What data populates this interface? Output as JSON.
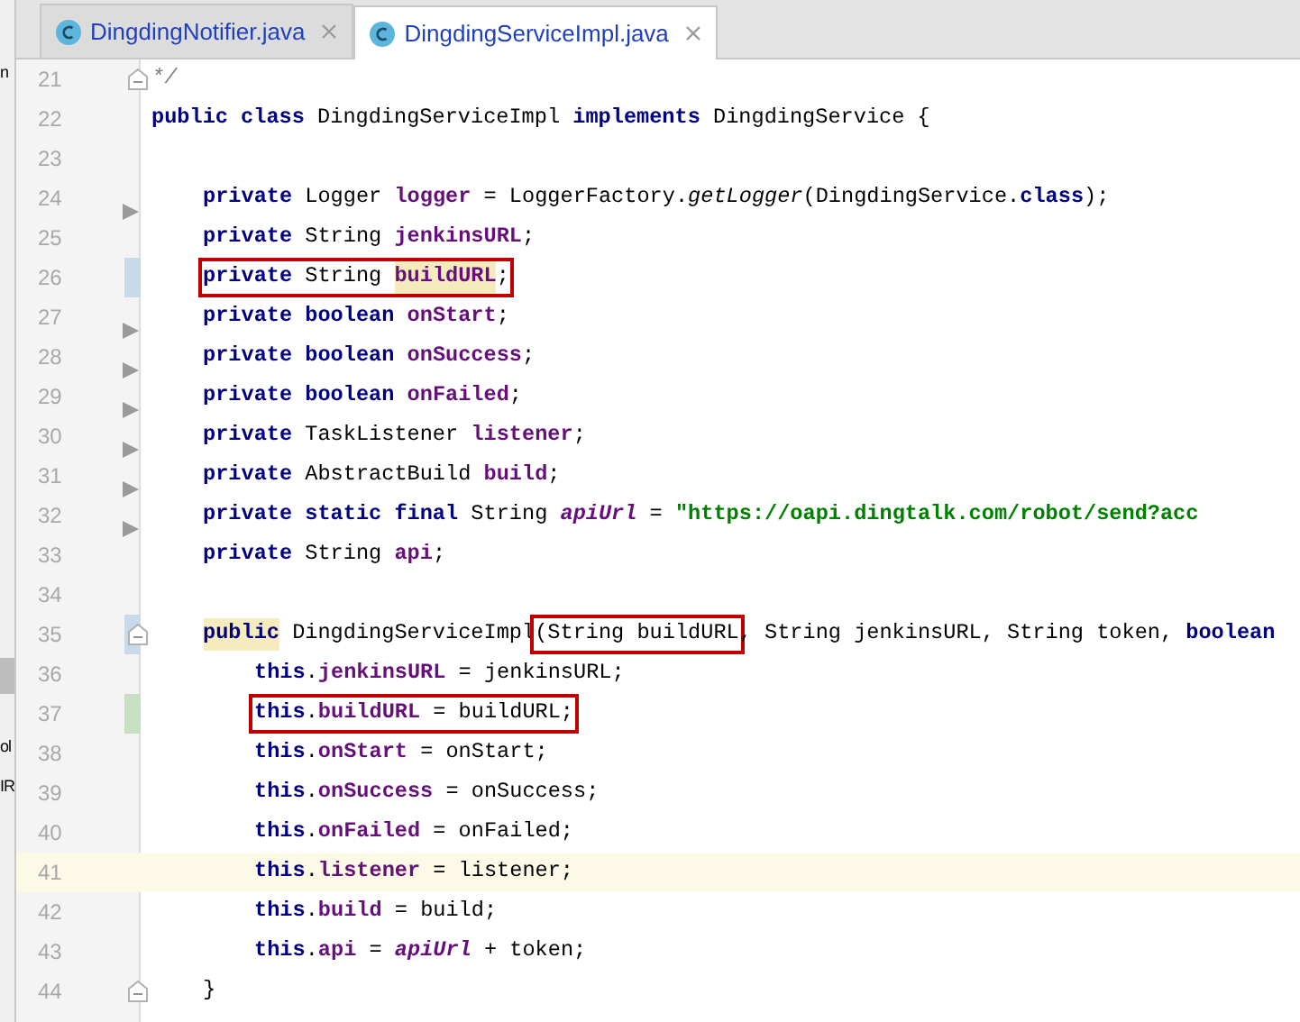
{
  "left_panel_fragments": [
    {
      "text": "n"
    },
    {
      "text": "ol"
    },
    {
      "text": "IR"
    }
  ],
  "tabs": [
    {
      "label": "DingdingNotifier.java",
      "selected": false
    },
    {
      "label": "DingdingServiceImpl.java",
      "selected": true
    }
  ],
  "lines": [
    {
      "number": "21",
      "current": false,
      "fold_marker": true,
      "arrow_marker": false,
      "modified": false,
      "added": false,
      "segments": [
        {
          "text": "*/",
          "kind": "comment"
        }
      ]
    },
    {
      "number": "22",
      "current": false,
      "fold_marker": false,
      "arrow_marker": false,
      "modified": false,
      "added": false,
      "segments": [
        {
          "text": "public class",
          "kind": "keyword"
        },
        {
          "text": " DingdingServiceImpl ",
          "kind": "plain"
        },
        {
          "text": "implements",
          "kind": "keyword"
        },
        {
          "text": " DingdingService {",
          "kind": "plain"
        }
      ],
      "children": [
        {
          "number": "23",
          "current": false,
          "fold_marker": false,
          "arrow_marker": false,
          "modified": false,
          "added": false
        },
        {
          "number": "24",
          "current": false,
          "fold_marker": false,
          "arrow_marker": true,
          "modified": false,
          "added": false,
          "segments": [
            {
              "text": "private",
              "kind": "keyword"
            },
            {
              "text": " Logger ",
              "kind": "plain"
            },
            {
              "text": "logger",
              "kind": "field"
            },
            {
              "text": " = LoggerFactory.",
              "kind": "plain"
            },
            {
              "text": "getLogger",
              "kind": "static_method"
            },
            {
              "text": "(DingdingService.",
              "kind": "plain"
            },
            {
              "text": "class",
              "kind": "keyword"
            },
            {
              "text": ");",
              "kind": "plain"
            }
          ]
        },
        {
          "number": "25",
          "current": false,
          "fold_marker": false,
          "arrow_marker": false,
          "modified": false,
          "added": false,
          "segments": [
            {
              "text": "private",
              "kind": "keyword"
            },
            {
              "text": " String ",
              "kind": "plain"
            },
            {
              "text": "jenkinsURL",
              "kind": "field"
            },
            {
              "text": ";",
              "kind": "plain"
            }
          ]
        },
        {
          "number": "26",
          "current": false,
          "fold_marker": false,
          "arrow_marker": false,
          "modified": true,
          "added": false,
          "segments": [
            {
              "kind": "boxed",
              "parts": [
                {
                  "text": "private",
                  "kind": "keyword"
                },
                {
                  "text": " String ",
                  "kind": "plain"
                },
                {
                  "text": "buildURL",
                  "kind": "highlighted_field"
                },
                {
                  "text": ";",
                  "kind": "plain"
                }
              ]
            }
          ]
        },
        {
          "number": "27",
          "current": false,
          "fold_marker": false,
          "arrow_marker": true,
          "modified": false,
          "added": false,
          "segments": [
            {
              "text": "private boolean ",
              "kind": "keyword"
            },
            {
              "text": "onStart",
              "kind": "field"
            },
            {
              "text": ";",
              "kind": "plain"
            }
          ]
        },
        {
          "number": "28",
          "current": false,
          "fold_marker": false,
          "arrow_marker": true,
          "modified": false,
          "added": false,
          "segments": [
            {
              "text": "private boolean ",
              "kind": "keyword"
            },
            {
              "text": "onSuccess",
              "kind": "field"
            },
            {
              "text": ";",
              "kind": "plain"
            }
          ]
        },
        {
          "number": "29",
          "current": false,
          "fold_marker": false,
          "arrow_marker": true,
          "modified": false,
          "added": false,
          "segments": [
            {
              "text": "private boolean ",
              "kind": "keyword"
            },
            {
              "text": "onFailed",
              "kind": "field"
            },
            {
              "text": ";",
              "kind": "plain"
            }
          ]
        },
        {
          "number": "30",
          "current": false,
          "fold_marker": false,
          "arrow_marker": true,
          "modified": false,
          "added": false,
          "segments": [
            {
              "text": "private",
              "kind": "keyword"
            },
            {
              "text": " TaskListener ",
              "kind": "plain"
            },
            {
              "text": "listener",
              "kind": "field"
            },
            {
              "text": ";",
              "kind": "plain"
            }
          ]
        },
        {
          "number": "31",
          "current": false,
          "fold_marker": false,
          "arrow_marker": true,
          "modified": false,
          "added": false,
          "segments": [
            {
              "text": "private",
              "kind": "keyword"
            },
            {
              "text": " AbstractBuild ",
              "kind": "plain"
            },
            {
              "text": "build",
              "kind": "field"
            },
            {
              "text": ";",
              "kind": "plain"
            }
          ]
        },
        {
          "number": "32",
          "current": false,
          "fold_marker": false,
          "arrow_marker": true,
          "modified": false,
          "added": false,
          "segments": [
            {
              "text": "private static final",
              "kind": "keyword"
            },
            {
              "text": " String ",
              "kind": "plain"
            },
            {
              "text": "apiUrl",
              "kind": "static_field"
            },
            {
              "text": " = ",
              "kind": "plain"
            },
            {
              "text": "\"https://oapi.dingtalk.com/robot/send?acc",
              "kind": "string"
            }
          ]
        },
        {
          "number": "33",
          "current": false,
          "fold_marker": false,
          "arrow_marker": false,
          "modified": false,
          "added": false,
          "segments": [
            {
              "text": "private",
              "kind": "keyword"
            },
            {
              "text": " String ",
              "kind": "plain"
            },
            {
              "text": "api",
              "kind": "field"
            },
            {
              "text": ";",
              "kind": "plain"
            }
          ]
        },
        {
          "number": "34",
          "current": false,
          "fold_marker": false,
          "arrow_marker": false,
          "modified": false,
          "added": false
        },
        {
          "number": "35",
          "current": false,
          "fold_marker": true,
          "arrow_marker": false,
          "modified": true,
          "added": false,
          "segments": [
            {
              "text": "public",
              "kind": "highlighted_keyword"
            },
            {
              "text": " DingdingServiceImpl",
              "kind": "plain"
            },
            {
              "kind": "boxed",
              "parts": [
                {
                  "text": "(String buildURL",
                  "kind": "plain"
                }
              ]
            },
            {
              "text": ", String jenkinsURL, String token, ",
              "kind": "plain"
            },
            {
              "text": "boolean",
              "kind": "keyword"
            }
          ],
          "children": [
            {
              "number": "36",
              "current": false,
              "fold_marker": false,
              "arrow_marker": false,
              "modified": false,
              "added": false,
              "segments": [
                {
                  "text": "this",
                  "kind": "keyword"
                },
                {
                  "text": ".",
                  "kind": "plain"
                },
                {
                  "text": "jenkinsURL",
                  "kind": "field"
                },
                {
                  "text": " = jenkinsURL;",
                  "kind": "plain"
                }
              ]
            },
            {
              "number": "37",
              "current": false,
              "fold_marker": false,
              "arrow_marker": false,
              "modified": false,
              "added": true,
              "segments": [
                {
                  "kind": "boxed",
                  "parts": [
                    {
                      "text": "this",
                      "kind": "keyword"
                    },
                    {
                      "text": ".",
                      "kind": "plain"
                    },
                    {
                      "text": "buildURL",
                      "kind": "field"
                    },
                    {
                      "text": " = buildURL;",
                      "kind": "plain"
                    }
                  ]
                }
              ]
            },
            {
              "number": "38",
              "current": false,
              "fold_marker": false,
              "arrow_marker": false,
              "modified": false,
              "added": false,
              "segments": [
                {
                  "text": "this",
                  "kind": "keyword"
                },
                {
                  "text": ".",
                  "kind": "plain"
                },
                {
                  "text": "onStart",
                  "kind": "field"
                },
                {
                  "text": " = onStart;",
                  "kind": "plain"
                }
              ]
            },
            {
              "number": "39",
              "current": false,
              "fold_marker": false,
              "arrow_marker": false,
              "modified": false,
              "added": false,
              "segments": [
                {
                  "text": "this",
                  "kind": "keyword"
                },
                {
                  "text": ".",
                  "kind": "plain"
                },
                {
                  "text": "onSuccess",
                  "kind": "field"
                },
                {
                  "text": " = onSuccess;",
                  "kind": "plain"
                }
              ]
            },
            {
              "number": "40",
              "current": false,
              "fold_marker": false,
              "arrow_marker": false,
              "modified": false,
              "added": false,
              "segments": [
                {
                  "text": "this",
                  "kind": "keyword"
                },
                {
                  "text": ".",
                  "kind": "plain"
                },
                {
                  "text": "onFailed",
                  "kind": "field"
                },
                {
                  "text": " = onFailed;",
                  "kind": "plain"
                }
              ]
            },
            {
              "number": "41",
              "current": true,
              "fold_marker": false,
              "arrow_marker": false,
              "modified": false,
              "added": false,
              "segments": [
                {
                  "text": "this",
                  "kind": "keyword"
                },
                {
                  "text": ".",
                  "kind": "plain"
                },
                {
                  "text": "listener",
                  "kind": "field"
                },
                {
                  "text": " = listener;",
                  "kind": "plain"
                }
              ]
            },
            {
              "number": "42",
              "current": false,
              "fold_marker": false,
              "arrow_marker": false,
              "modified": false,
              "added": false,
              "segments": [
                {
                  "text": "this",
                  "kind": "keyword"
                },
                {
                  "text": ".",
                  "kind": "plain"
                },
                {
                  "text": "build",
                  "kind": "field"
                },
                {
                  "text": " = build;",
                  "kind": "plain"
                }
              ]
            },
            {
              "number": "43",
              "current": false,
              "fold_marker": false,
              "arrow_marker": false,
              "modified": false,
              "added": false,
              "segments": [
                {
                  "text": "this",
                  "kind": "keyword"
                },
                {
                  "text": ".",
                  "kind": "plain"
                },
                {
                  "text": "api",
                  "kind": "field"
                },
                {
                  "text": " = ",
                  "kind": "plain"
                },
                {
                  "text": "apiUrl",
                  "kind": "static_field"
                },
                {
                  "text": " + token;",
                  "kind": "plain"
                }
              ]
            }
          ]
        },
        {
          "number": "44",
          "current": false,
          "fold_marker": true,
          "arrow_marker": false,
          "modified": false,
          "added": false,
          "segments": [
            {
              "text": "}",
              "kind": "plain"
            }
          ]
        }
      ]
    }
  ]
}
